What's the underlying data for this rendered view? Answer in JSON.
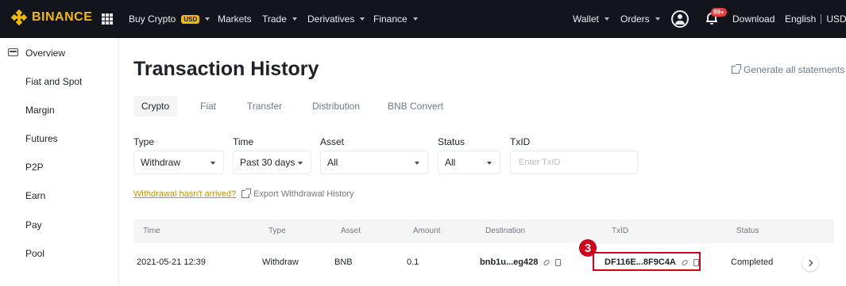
{
  "nav": {
    "logo": "BINANCE",
    "buy_crypto": "Buy Crypto",
    "currency_badge": "USD",
    "markets": "Markets",
    "trade": "Trade",
    "derivatives": "Derivatives",
    "finance": "Finance",
    "wallet": "Wallet",
    "orders": "Orders",
    "notif_count": "99+",
    "download": "Download",
    "language": "English",
    "currency": "USD"
  },
  "sidebar": {
    "items": [
      "Overview",
      "Fiat and Spot",
      "Margin",
      "Futures",
      "P2P",
      "Earn",
      "Pay",
      "Pool"
    ]
  },
  "main": {
    "title": "Transaction History",
    "generate_link": "Generate all statements",
    "tabs": [
      "Crypto",
      "Fiat",
      "Transfer",
      "Distribution",
      "BNB Convert"
    ],
    "active_tab": "Crypto",
    "filters": {
      "type_label": "Type",
      "type_value": "Withdraw",
      "time_label": "Time",
      "time_value": "Past 30 days",
      "asset_label": "Asset",
      "asset_value": "All",
      "status_label": "Status",
      "status_value": "All",
      "txid_label": "TxID",
      "txid_placeholder": "Enter TxID"
    },
    "withdrawal_link": "Withdrawal hasn't arrived?",
    "export_link": "Export Withdrawal History",
    "table": {
      "headers": [
        "Time",
        "Type",
        "Asset",
        "Amount",
        "Destination",
        "TxID",
        "Status"
      ],
      "rows": [
        {
          "time": "2021-05-21 12:39",
          "type": "Withdraw",
          "asset": "BNB",
          "amount": "0.1",
          "destination": "bnb1u...eg428",
          "txid": "DF116E...8F9C4A",
          "status": "Completed"
        }
      ]
    },
    "step_badge": "3"
  },
  "colors": {
    "brand": "#f0b90b",
    "nav_bg": "#12161c",
    "highlight": "#d0021b",
    "warning_link": "#c99400"
  }
}
